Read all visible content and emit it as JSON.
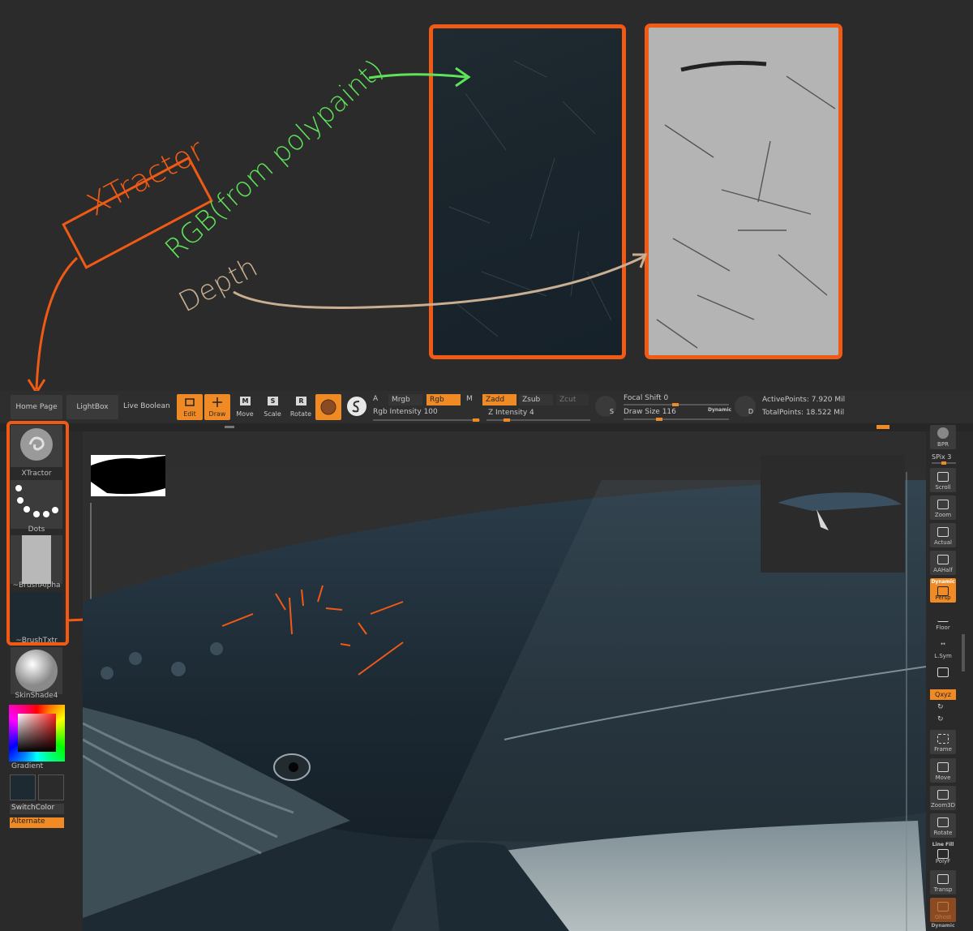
{
  "annotations": {
    "xtractor_label": "XTractor",
    "rgb_label": "RGB(from polypaint)",
    "depth_label": "Depth"
  },
  "toolbar": {
    "home_page": "Home Page",
    "lightbox": "LightBox",
    "live_boolean": "Live Boolean",
    "edit": "Edit",
    "draw": "Draw",
    "move": "Move",
    "scale": "Scale",
    "rotate": "Rotate",
    "a_label": "A",
    "mrgb": "Mrgb",
    "rgb": "Rgb",
    "m_label": "M",
    "rgb_intensity": "Rgb Intensity 100",
    "zadd": "Zadd",
    "zsub": "Zsub",
    "zcut": "Zcut",
    "z_intensity": "Z Intensity 4",
    "focal_shift": "Focal Shift 0",
    "draw_size": "Draw Size 116",
    "dynamic": "Dynamic",
    "active_points": "ActivePoints: 7.920 Mil",
    "total_points": "TotalPoints: 18.522 Mil",
    "s_key": "S",
    "d_key": "D"
  },
  "left_shelf": {
    "brush_label": "XTractor",
    "stroke_label": "Dots",
    "alpha_label": "~BrushAlpha",
    "texture_label": "~BrushTxtr",
    "material_label": "SkinShade4",
    "gradient_label": "Gradient",
    "switchcolor_label": "SwitchColor",
    "alternate_label": "Alternate"
  },
  "right_shelf": {
    "bpr": "BPR",
    "spix": "SPix 3",
    "scroll": "Scroll",
    "zoom": "Zoom",
    "actual": "Actual",
    "aahalf": "AAHalf",
    "dynamic": "Dynamic",
    "persp": "Persp",
    "floor": "Floor",
    "lsym": "L.Sym",
    "xyz": "Qxyz",
    "frame": "Frame",
    "move": "Move",
    "zoom3d": "Zoom3D",
    "rotate": "Rotate",
    "linefill": "Line Fill",
    "polyf": "PolyF",
    "transp": "Transp",
    "ghost": "Ghost",
    "dynamic2": "Dynamic"
  },
  "colors": {
    "accent": "#f08a24",
    "annotation_orange": "#f05a14",
    "annotation_green": "#5fe35a",
    "annotation_tan": "#c9ae92"
  },
  "icons": [
    "xtractor-brush-icon",
    "dots-stroke-icon",
    "edit-icon",
    "draw-icon",
    "move-icon",
    "scale-icon",
    "rotate-icon",
    "material-sphere-icon",
    "s-curve-icon",
    "bpr-icon",
    "scroll-hand-icon",
    "zoom-icon",
    "persp-grid-icon",
    "floor-icon",
    "lsym-icon",
    "lock-icon",
    "frame-icon",
    "ghost-icon"
  ]
}
